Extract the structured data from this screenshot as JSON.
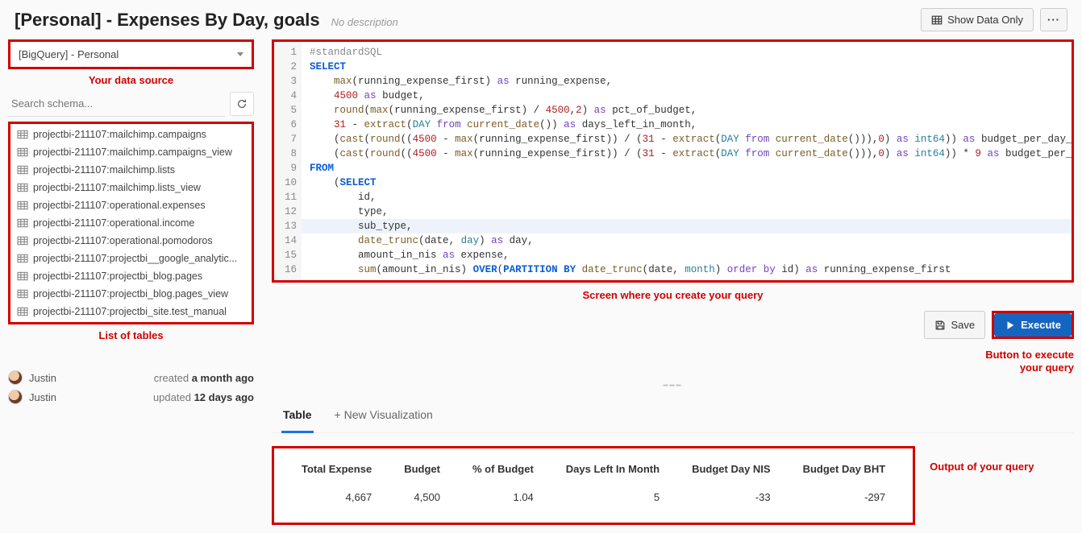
{
  "header": {
    "title": "[Personal] - Expenses By Day, goals",
    "description": "No description",
    "show_data_only": "Show Data Only"
  },
  "annotations": {
    "data_source": "Your data source",
    "tables": "List of tables",
    "query_area": "Screen where you create your query",
    "execute": "Button to execute your query",
    "output": "Output of your query"
  },
  "sidebar": {
    "data_source": "[BigQuery] - Personal",
    "search_placeholder": "Search schema...",
    "tables": [
      "projectbi-211107:mailchimp.campaigns",
      "projectbi-211107:mailchimp.campaigns_view",
      "projectbi-211107:mailchimp.lists",
      "projectbi-211107:mailchimp.lists_view",
      "projectbi-211107:operational.expenses",
      "projectbi-211107:operational.income",
      "projectbi-211107:operational.pomodoros",
      "projectbi-211107:projectbi__google_analytic...",
      "projectbi-211107:projectbi_blog.pages",
      "projectbi-211107:projectbi_blog.pages_view",
      "projectbi-211107:projectbi_site.test_manual"
    ],
    "meta": {
      "created_by": "Justin",
      "created_label": "created",
      "created_time": "a month ago",
      "updated_by": "Justin",
      "updated_label": "updated",
      "updated_time": "12 days ago"
    }
  },
  "editor": {
    "line_count": 16,
    "highlight_line": 13
  },
  "actions": {
    "save": "Save",
    "execute": "Execute"
  },
  "tabs": {
    "table": "Table",
    "new_viz": "+ New Visualization"
  },
  "result": {
    "headers": [
      "Total Expense",
      "Budget",
      "% of Budget",
      "Days Left In Month",
      "Budget Day NIS",
      "Budget Day BHT"
    ],
    "row": [
      "4,667",
      "4,500",
      "1.04",
      "5",
      "-33",
      "-297"
    ]
  }
}
